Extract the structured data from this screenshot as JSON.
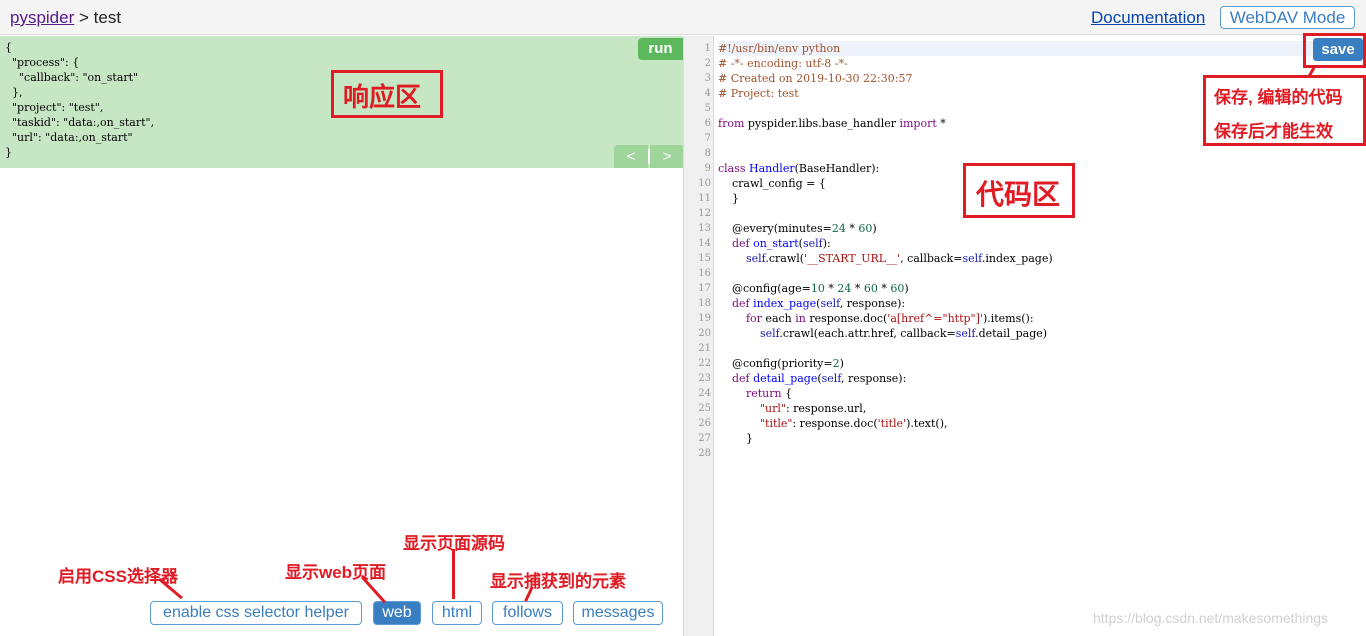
{
  "header": {
    "breadcrumb_link": "pyspider",
    "breadcrumb_sep": ">",
    "breadcrumb_current": "test",
    "doc_link": "Documentation",
    "webdav_button": "WebDAV Mode"
  },
  "response": {
    "run_label": "run",
    "prev_label": "<",
    "sep_label": "|",
    "next_label": ">",
    "lines": [
      "{",
      "  \"process\": {",
      "    \"callback\": \"on_start\"",
      "  },",
      "  \"project\": \"test\",",
      "  \"taskid\": \"data:,on_start\",",
      "  \"url\": \"data:,on_start\"",
      "}"
    ]
  },
  "tabs": [
    {
      "label": "enable css selector helper",
      "active": false
    },
    {
      "label": "web",
      "active": true
    },
    {
      "label": "html",
      "active": false
    },
    {
      "label": "follows",
      "active": false
    },
    {
      "label": "messages",
      "active": false
    }
  ],
  "editor": {
    "save_label": "save",
    "line_numbers": [
      "1",
      "2",
      "3",
      "4",
      "5",
      "6",
      "7",
      "8",
      "9",
      "10",
      "11",
      "12",
      "13",
      "14",
      "15",
      "16",
      "17",
      "18",
      "19",
      "20",
      "21",
      "22",
      "23",
      "24",
      "25",
      "26",
      "27",
      "28"
    ],
    "lines": [
      "#!/usr/bin/env python",
      "# -*- encoding: utf-8 -*-",
      "# Created on 2019-10-30 22:30:57",
      "# Project: test",
      "",
      "from pyspider.libs.base_handler import *",
      "",
      "",
      "class Handler(BaseHandler):",
      "    crawl_config = {",
      "    }",
      "",
      "    @every(minutes=24 * 60)",
      "    def on_start(self):",
      "        self.crawl('__START_URL__', callback=self.index_page)",
      "",
      "    @config(age=10 * 24 * 60 * 60)",
      "    def index_page(self, response):",
      "        for each in response.doc('a[href^=\"http\"]').items():",
      "            self.crawl(each.attr.href, callback=self.detail_page)",
      "",
      "    @config(priority=2)",
      "    def detail_page(self, response):",
      "        return {",
      "            \"url\": response.url,",
      "            \"title\": response.doc('title').text(),",
      "        }",
      ""
    ]
  },
  "annotations": {
    "response_area": "响应区",
    "code_area": "代码区",
    "save_note_1": "保存, 编辑的代码",
    "save_note_2": "保存后才能生效",
    "css_helper": "启用CSS选择器",
    "web_page": "显示web页面",
    "html_source": "显示页面源码",
    "follows": "显示捕获到的元素"
  },
  "watermark": "https://blog.csdn.net/makesomethings",
  "colors": {
    "response_bg": "#c7e6c4",
    "run_green": "#5cb85c",
    "save_blue": "#3a7ec2",
    "annotation_red": "#e01b24"
  }
}
